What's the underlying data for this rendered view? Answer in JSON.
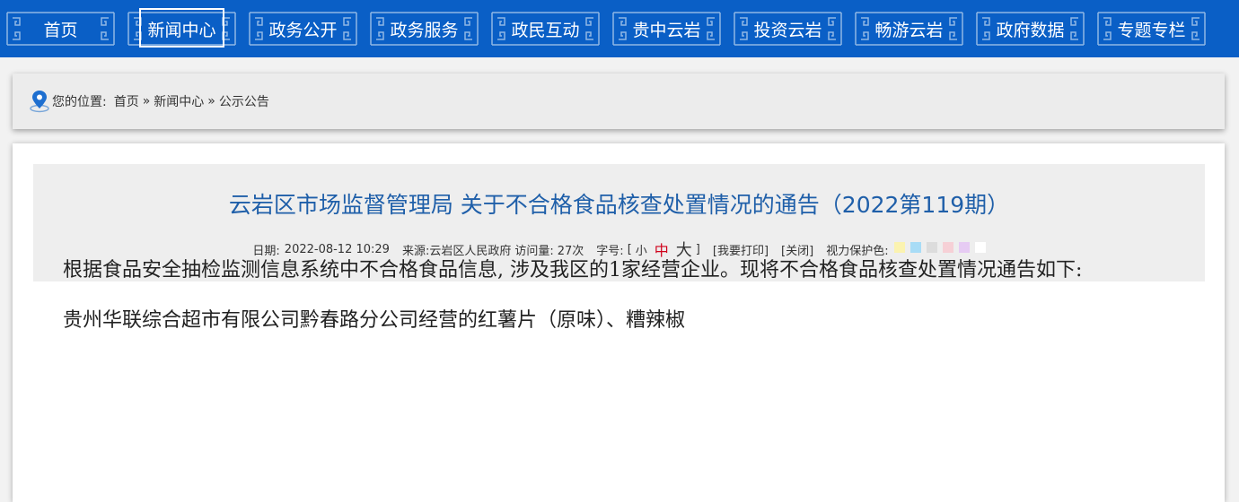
{
  "nav": {
    "items": [
      {
        "label": "首页"
      },
      {
        "label": "新闻中心"
      },
      {
        "label": "政务公开"
      },
      {
        "label": "政务服务"
      },
      {
        "label": "政民互动"
      },
      {
        "label": "贵中云岩"
      },
      {
        "label": "投资云岩"
      },
      {
        "label": "畅游云岩"
      },
      {
        "label": "政府数据"
      },
      {
        "label": "专题专栏"
      }
    ],
    "active_index": 1
  },
  "breadcrumb": {
    "prefix": "您的位置:",
    "home": "首页",
    "separator": "»",
    "level1": "新闻中心",
    "level2": "公示公告"
  },
  "article": {
    "title": "云岩区市场监督管理局 关于不合格食品核查处置情况的通告（2022第119期）",
    "date_label": "日期:",
    "date": "2022-08-12 10:29",
    "source_label": "来源:",
    "source": "云岩区人民政府",
    "views_label": "访问量:",
    "views": "27次",
    "fontsize_label": "字号:",
    "bracket_open": "[",
    "bracket_close": "]",
    "font_small": "小",
    "font_medium": "中",
    "font_large": "大",
    "print": "[我要打印]",
    "close": "[关闭]",
    "eye_label": "视力保护色:",
    "eye_colors": [
      "#fbf3b0",
      "#a8dcf6",
      "#dcdcdc",
      "#f6d0d6",
      "#e6cbf3",
      "#ffffff"
    ],
    "paragraphs": [
      "根据食品安全抽检监测信息系统中不合格食品信息, 涉及我区的1家经营企业。现将不合格食品核查处置情况通告如下:",
      "贵州华联综合超市有限公司黔春路分公司经营的红薯片（原味）、糟辣椒"
    ]
  },
  "colors": {
    "nav_bg": "#0a5fc6",
    "title": "#1f5fa9",
    "font_medium_active": "#d0021b"
  }
}
